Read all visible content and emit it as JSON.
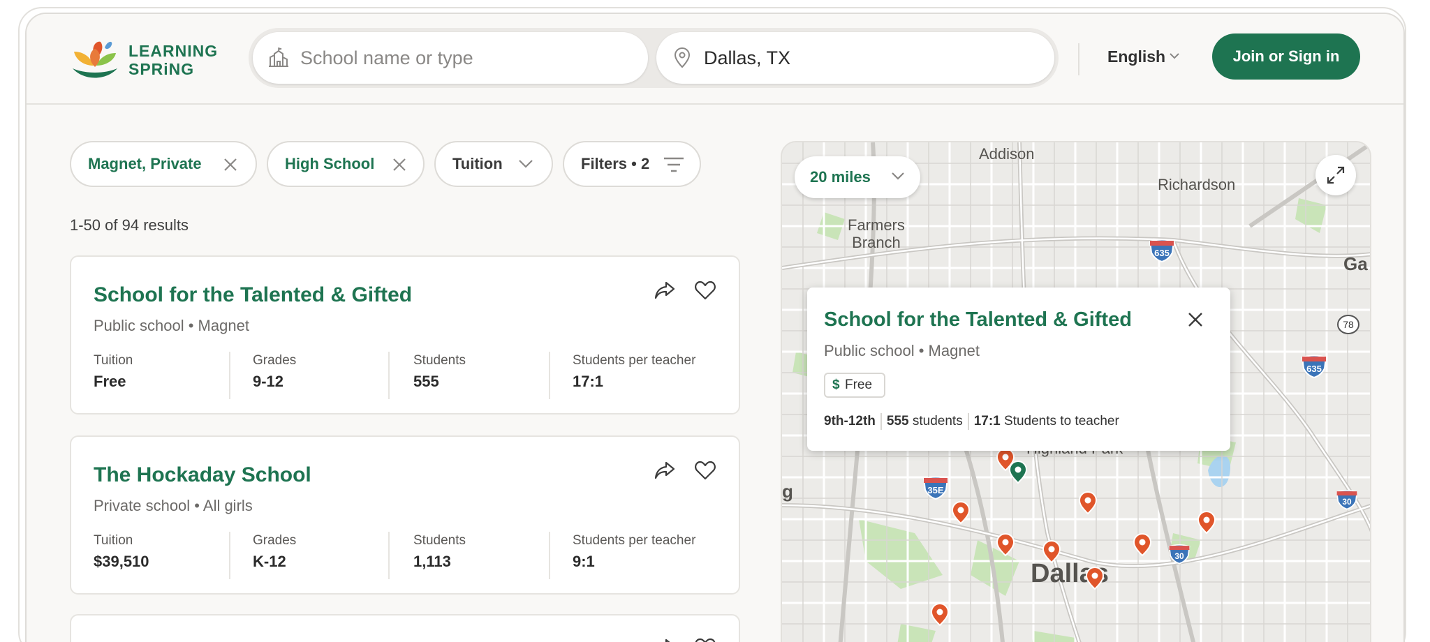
{
  "header": {
    "logo_line1": "LEARNING",
    "logo_line2": "SPRiNG",
    "school_search_placeholder": "School name or type",
    "location_value": "Dallas, TX",
    "language": "English",
    "signin_label": "Join or Sign in"
  },
  "filters": [
    {
      "label": "Magnet, Private",
      "removable": true
    },
    {
      "label": "High School",
      "removable": true
    },
    {
      "label": "Tuition",
      "dropdown": true
    },
    {
      "label": "Filters • 2",
      "icon": "filter-icon"
    }
  ],
  "results": {
    "count_text": "1-50 of 94 results",
    "cards": [
      {
        "title": "School for the Talented & Gifted",
        "subtitle": "Public school • Magnet",
        "stats": [
          {
            "label": "Tuition",
            "value": "Free"
          },
          {
            "label": "Grades",
            "value": "9-12"
          },
          {
            "label": "Students",
            "value": "555"
          },
          {
            "label": "Students per teacher",
            "value": "17:1"
          }
        ]
      },
      {
        "title": "The Hockaday School",
        "subtitle": "Private school • All girls",
        "stats": [
          {
            "label": "Tuition",
            "value": "$39,510"
          },
          {
            "label": "Grades",
            "value": "K-12"
          },
          {
            "label": "Students",
            "value": "1,113"
          },
          {
            "label": "Students per teacher",
            "value": "9:1"
          }
        ]
      }
    ]
  },
  "map": {
    "radius_label": "20 miles",
    "places": [
      "Addison",
      "Richardson",
      "Farmers\nBranch",
      "Ga",
      "g",
      "Highland Park",
      "Dallas"
    ],
    "highways": [
      "635",
      "635",
      "78",
      "35E",
      "30",
      "30"
    ],
    "popup": {
      "title": "School for the Talented & Gifted",
      "subtitle": "Public school • Magnet",
      "badge": "Free",
      "badge_symbol": "$",
      "grades": "9th-12th",
      "students_num": "555",
      "students_word": "students",
      "ratio": "17:1",
      "ratio_text": "Students to teacher"
    }
  },
  "colors": {
    "brand_green": "#1e7451",
    "pin_orange": "#e0552a",
    "pin_green": "#1e7451"
  }
}
